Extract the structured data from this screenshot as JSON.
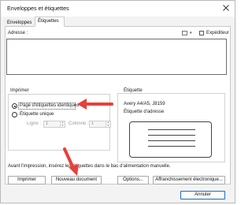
{
  "window": {
    "title": "Enveloppes et étiquettes"
  },
  "tabs": [
    {
      "label": "Enveloppes",
      "active": false
    },
    {
      "label": "Étiquettes",
      "active": true
    }
  ],
  "address": {
    "label": "Adresse :",
    "value": "",
    "sender_label": "Expéditeur",
    "sender_checked": false
  },
  "print_group": {
    "title": "Imprimer",
    "options": [
      {
        "label": "Page d'étiquettes identiques",
        "selected": true
      },
      {
        "label": "Étiquette unique",
        "selected": false
      }
    ],
    "row_label": "Ligne :",
    "row_value": "1",
    "column_label": "Colonne :",
    "column_value": "1"
  },
  "label_group": {
    "title": "Étiquette",
    "product": "Avery A4/A5, J8159",
    "type": "Étiquette d'adresse"
  },
  "notice": "Avant l'impression, insérez les étiquettes dans le bac d'alimentation manuelle.",
  "buttons": {
    "print": "Imprimer",
    "new_document": "Nouveau document",
    "options": "Options...",
    "postage": "Affranchissement électronique...",
    "cancel": "Annuler"
  },
  "icons": {
    "close": "close-icon",
    "address_book": "address-book-icon",
    "arrow_color": "#e8403a"
  }
}
